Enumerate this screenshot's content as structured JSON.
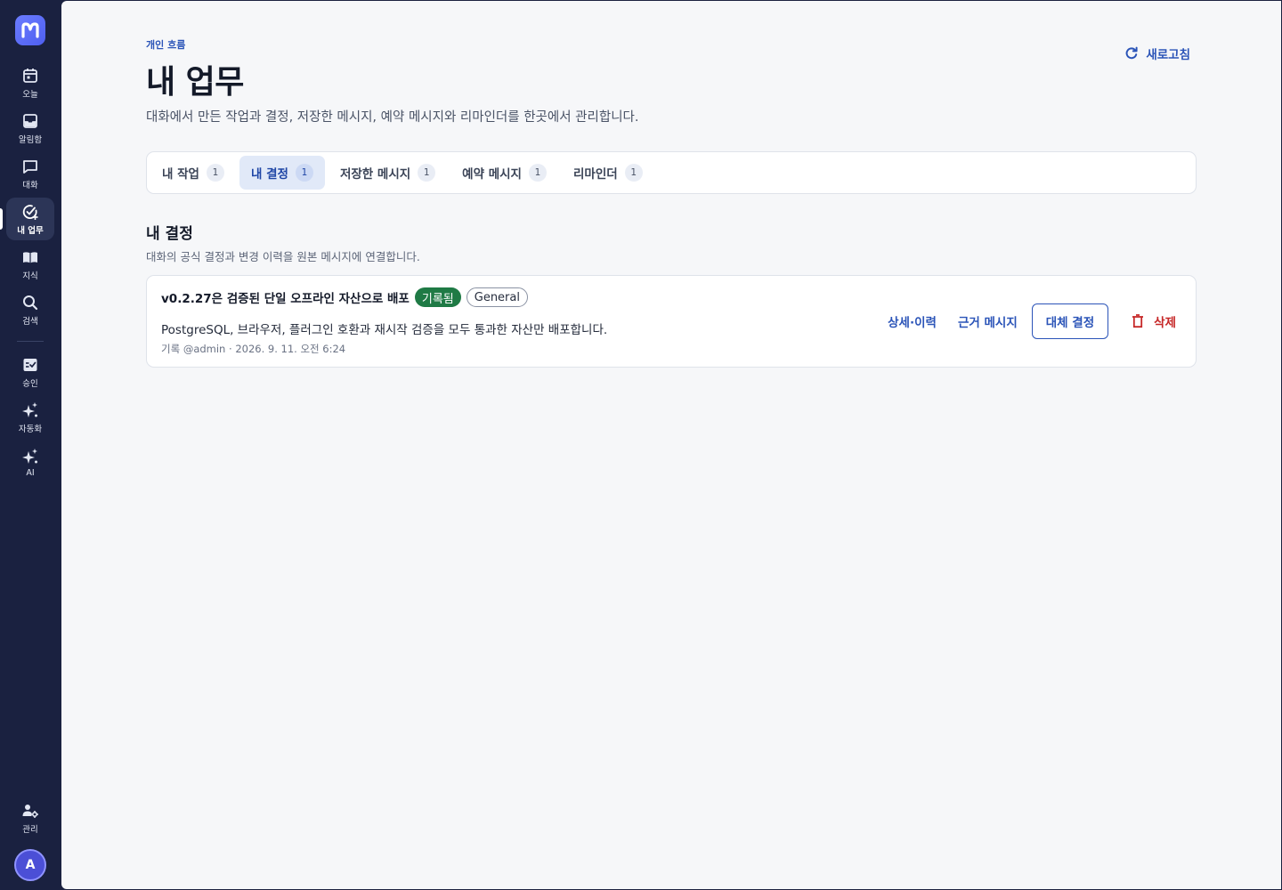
{
  "sidebar": {
    "logo_letter": "M",
    "items": [
      {
        "label": "오늘",
        "icon": "calendar-icon"
      },
      {
        "label": "알림함",
        "icon": "inbox-icon"
      },
      {
        "label": "대화",
        "icon": "chat-bubble-icon"
      },
      {
        "label": "내 업무",
        "icon": "task-check-icon",
        "active": true
      },
      {
        "label": "지식",
        "icon": "book-icon"
      },
      {
        "label": "검색",
        "icon": "search-icon"
      },
      {
        "label": "승인",
        "icon": "approval-checklist-icon"
      },
      {
        "label": "자동화",
        "icon": "sparkle-icon"
      },
      {
        "label": "AI",
        "icon": "sparkle-icon"
      }
    ],
    "admin_label": "관리",
    "avatar_initial": "A"
  },
  "header": {
    "eyebrow": "개인 흐름",
    "title": "내 업무",
    "description": "대화에서 만든 작업과 결정, 저장한 메시지, 예약 메시지와 리마인더를 한곳에서 관리합니다.",
    "refresh_label": "새로고침"
  },
  "tabs": [
    {
      "label": "내 작업",
      "count": "1"
    },
    {
      "label": "내 결정",
      "count": "1",
      "active": true
    },
    {
      "label": "저장한 메시지",
      "count": "1"
    },
    {
      "label": "예약 메시지",
      "count": "1"
    },
    {
      "label": "리마인더",
      "count": "1"
    }
  ],
  "section": {
    "title": "내 결정",
    "description": "대화의 공식 결정과 변경 이력을 원본 메시지에 연결합니다."
  },
  "decisions": [
    {
      "title": "v0.2.27은 검증된 단일 오프라인 자산으로 배포",
      "status": "기록됨",
      "channel": "General",
      "body": "PostgreSQL, 브라우저, 플러그인 호환과 재시작 검증을 모두 통과한 자산만 배포합니다.",
      "meta": "기록 @admin · 2026. 9. 11. 오전 6:24",
      "actions": {
        "details": "상세·이력",
        "evidence": "근거 메시지",
        "supersede": "대체 결정",
        "delete": "삭제"
      }
    }
  ],
  "colors": {
    "sidebar_bg": "#1a2140",
    "accent": "#2b54b8",
    "recorded_badge": "#1f7a45",
    "danger": "#c62828"
  }
}
